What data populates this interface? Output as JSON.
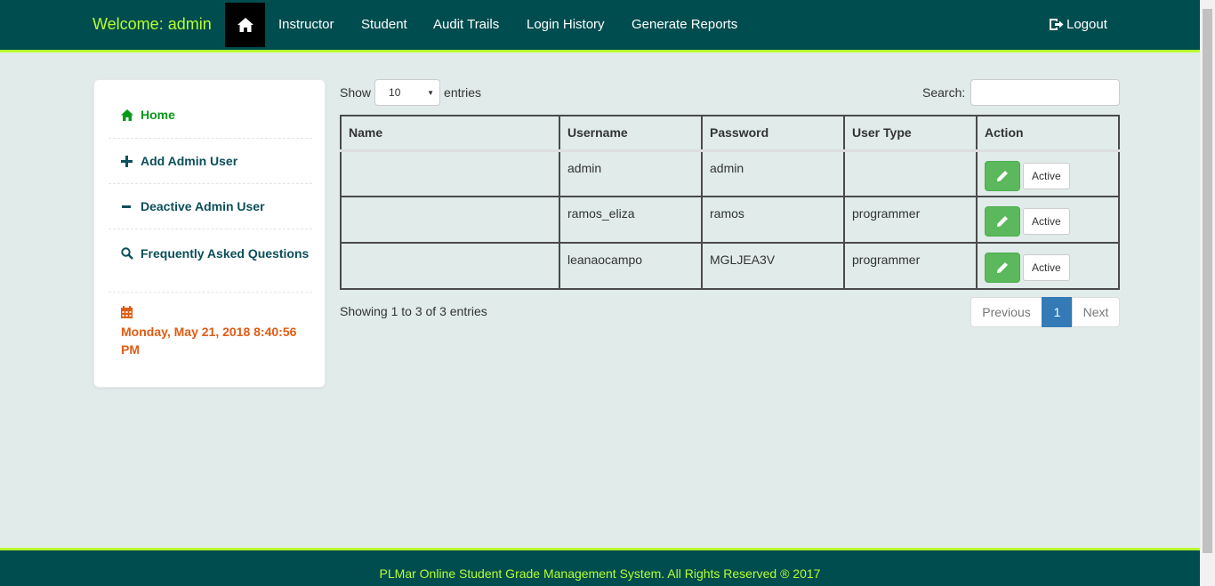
{
  "navbar": {
    "brand": "Welcome: admin",
    "links": [
      "Instructor",
      "Student",
      "Audit Trails",
      "Login History",
      "Generate Reports"
    ],
    "logout": "Logout"
  },
  "sidebar": {
    "items": [
      {
        "label": "Home",
        "icon": "home-icon"
      },
      {
        "label": "Add Admin User",
        "icon": "plus-icon"
      },
      {
        "label": "Deactive Admin User",
        "icon": "minus-icon"
      },
      {
        "label": "Frequently Asked Questions",
        "icon": "search-icon"
      }
    ],
    "datetime": "Monday, May 21, 2018 8:40:56 PM"
  },
  "table_controls": {
    "show_label": "Show",
    "entries_value": "10",
    "entries_label": "entries",
    "search_label": "Search:",
    "search_value": ""
  },
  "table": {
    "headers": [
      "Name",
      "Username",
      "Password",
      "User Type",
      "Action"
    ],
    "rows": [
      {
        "name": "",
        "username": "admin",
        "password": "admin",
        "user_type": "",
        "status": "Active"
      },
      {
        "name": "",
        "username": "ramos_eliza",
        "password": "ramos",
        "user_type": "programmer",
        "status": "Active"
      },
      {
        "name": "",
        "username": "leanaocampo",
        "password": "MGLJEA3V",
        "user_type": "programmer",
        "status": "Active"
      }
    ]
  },
  "info": "Showing 1 to 3 of 3 entries",
  "pagination": {
    "previous": "Previous",
    "current": "1",
    "next": "Next"
  },
  "footer": "PLMar Online Student Grade Management System. All Rights Reserved ® 2017",
  "colors": {
    "nav_bg": "#004d4f",
    "accent": "#b8ff2d",
    "date": "#e05c14",
    "edit": "#5cb85c",
    "page_current": "#337ab7"
  }
}
